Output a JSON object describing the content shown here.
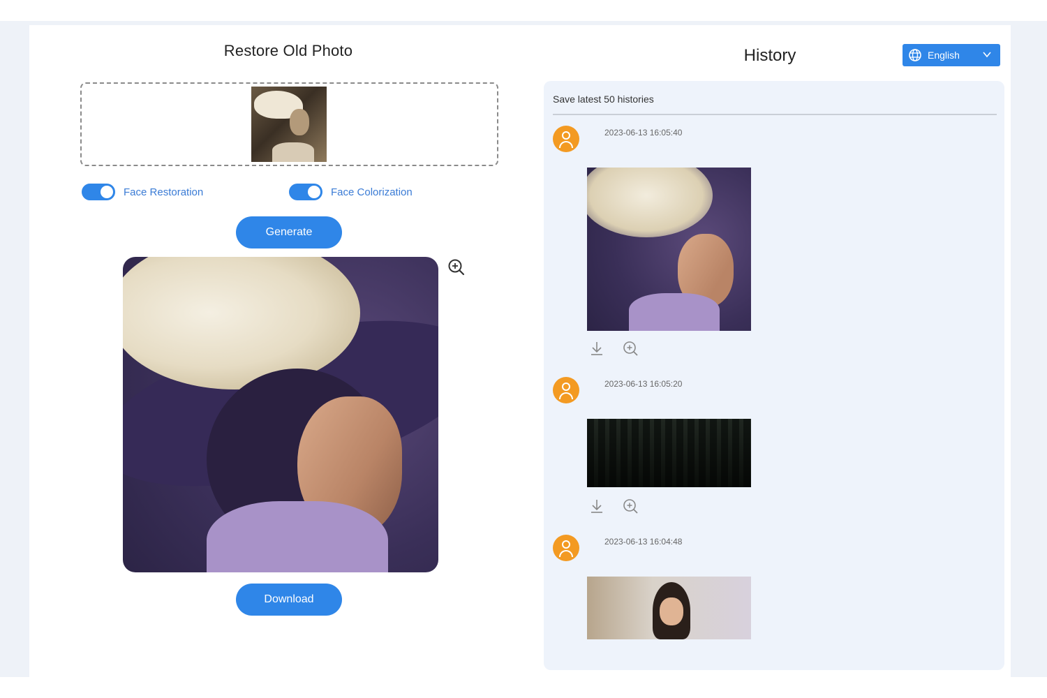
{
  "left": {
    "title": "Restore Old Photo",
    "toggles": [
      {
        "label": "Face Restoration",
        "on": true
      },
      {
        "label": "Face Colorization",
        "on": true
      }
    ],
    "generate_label": "Generate",
    "download_label": "Download"
  },
  "right": {
    "title": "History",
    "language": "English",
    "caption": "Save latest 50 histories",
    "items": [
      {
        "timestamp": "2023-06-13 16:05:40"
      },
      {
        "timestamp": "2023-06-13 16:05:20"
      },
      {
        "timestamp": "2023-06-13 16:04:48"
      }
    ]
  },
  "colors": {
    "accent": "#2f86e8",
    "avatar": "#f39a22",
    "history_bg": "#eef3fb"
  },
  "icons": [
    "zoom-in-icon",
    "download-icon",
    "globe-icon",
    "chevron-down-icon",
    "user-icon"
  ]
}
